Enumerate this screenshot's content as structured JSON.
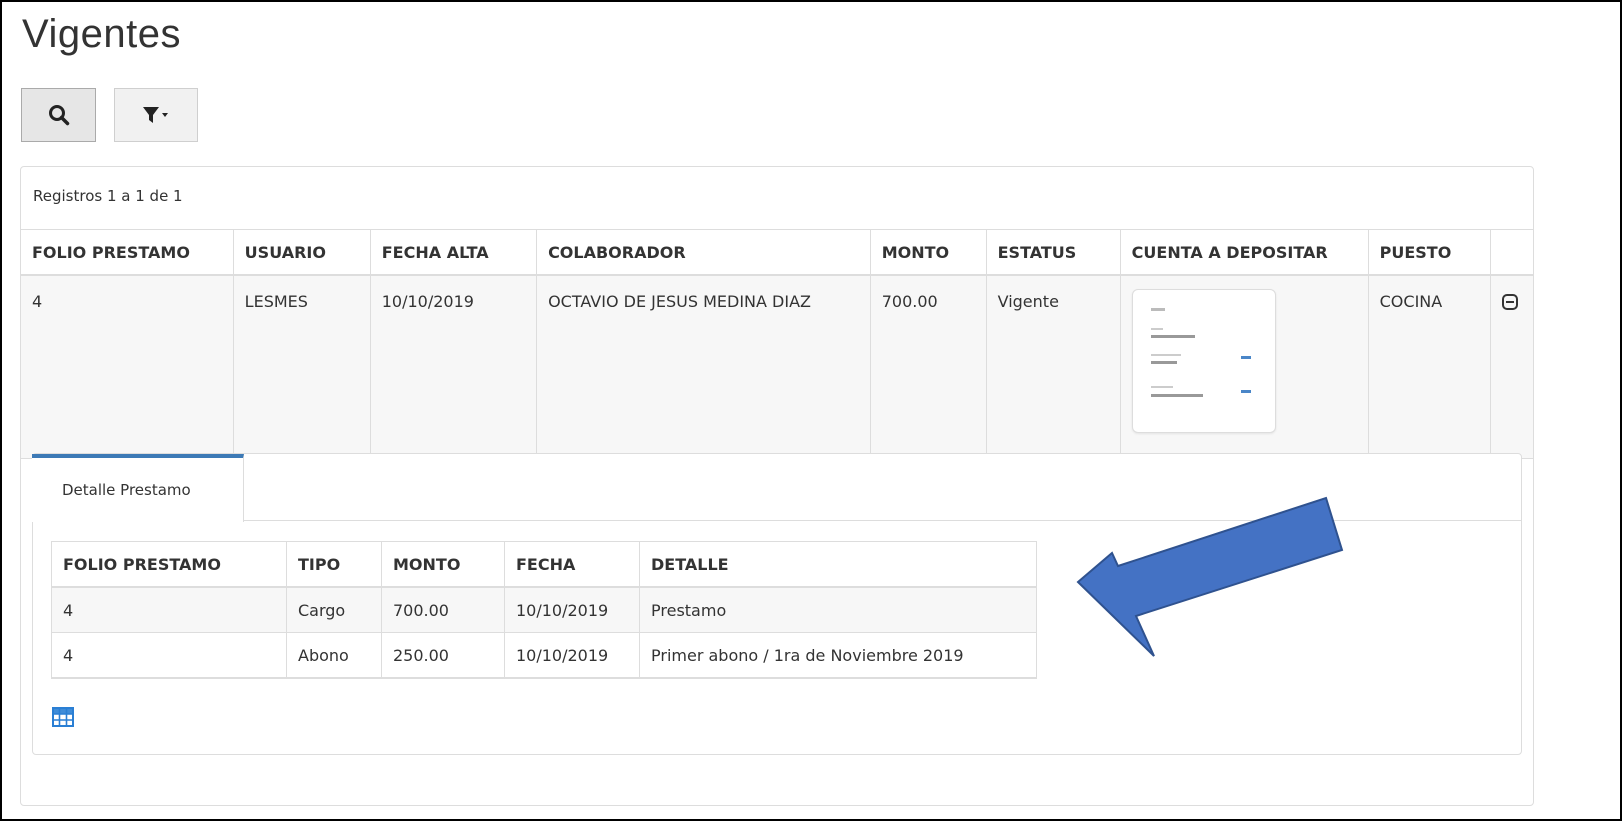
{
  "page": {
    "title": "Vigentes"
  },
  "toolbar": {
    "search_icon": "search-icon",
    "filter_icon": "filter-dropdown-icon"
  },
  "records": {
    "summary": "Registros 1 a 1 de 1"
  },
  "main_table": {
    "headers": [
      "FOLIO PRESTAMO",
      "USUARIO",
      "FECHA ALTA",
      "COLABORADOR",
      "MONTO",
      "ESTATUS",
      "CUENTA A DEPOSITAR",
      "PUESTO",
      ""
    ],
    "rows": [
      {
        "folio": "4",
        "usuario": "LESMES",
        "fecha_alta": "10/10/2019",
        "colaborador": "OCTAVIO DE JESUS MEDINA DIAZ",
        "monto": "700.00",
        "estatus": "Vigente",
        "puesto": "COCINA"
      }
    ]
  },
  "detail": {
    "tab_label": "Detalle Prestamo",
    "headers": [
      "FOLIO PRESTAMO",
      "TIPO",
      "MONTO",
      "FECHA",
      "DETALLE"
    ],
    "rows": [
      {
        "folio": "4",
        "tipo": "Cargo",
        "monto": "700.00",
        "fecha": "10/10/2019",
        "detalle": "Prestamo"
      },
      {
        "folio": "4",
        "tipo": "Abono",
        "monto": "250.00",
        "fecha": "10/10/2019",
        "detalle": "Primer abono / 1ra de Noviembre 2019"
      }
    ]
  },
  "colors": {
    "accent": "#3d7ab6",
    "arrow": "#4472c4",
    "arrow_border": "#2f528f",
    "grid_icon": "#2a7fd4"
  }
}
